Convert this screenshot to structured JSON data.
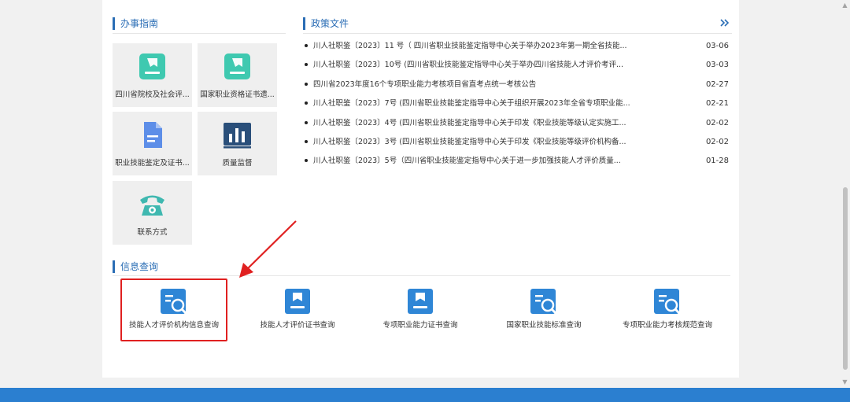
{
  "guide": {
    "title": "办事指南",
    "tiles": [
      {
        "label": "四川省院校及社会评...",
        "icon": "bookmark-book-icon",
        "color": "#3fc9b0"
      },
      {
        "label": "国家职业资格证书遗...",
        "icon": "bookmark-book-icon",
        "color": "#3fc9b0"
      },
      {
        "label": "职业技能鉴定及证书...",
        "icon": "document-icon",
        "color": "#5d8ee8"
      },
      {
        "label": "质量监督",
        "icon": "bar-chart-icon",
        "color": "#2a4f7a"
      },
      {
        "label": "联系方式",
        "icon": "telephone-icon",
        "color": "#3fb8b0"
      }
    ]
  },
  "policy": {
    "title": "政策文件",
    "more_icon": "double-chevron-right-icon",
    "items": [
      {
        "title": "川人社职鉴〔2023〕11 号（ 四川省职业技能鉴定指导中心关于举办2023年第一期全省技能...",
        "date": "03-06"
      },
      {
        "title": "川人社职鉴〔2023〕10号 (四川省职业技能鉴定指导中心关于举办四川省技能人才评价考评...",
        "date": "03-03"
      },
      {
        "title": "四川省2023年度16个专项职业能力考核项目省直考点统一考核公告",
        "date": "02-27"
      },
      {
        "title": "川人社职鉴〔2023〕7号 (四川省职业技能鉴定指导中心关于组织开展2023年全省专项职业能...",
        "date": "02-21"
      },
      {
        "title": "川人社职鉴〔2023〕4号 (四川省职业技能鉴定指导中心关于印发《职业技能等级认定实施工...",
        "date": "02-02"
      },
      {
        "title": "川人社职鉴〔2023〕3号 (四川省职业技能鉴定指导中心关于印发《职业技能等级评价机构备...",
        "date": "02-02"
      },
      {
        "title": "川人社职鉴〔2023〕5号（四川省职业技能鉴定指导中心关于进一步加强技能人才评价质量...",
        "date": "01-28"
      }
    ]
  },
  "query": {
    "title": "信息查询",
    "items": [
      {
        "label": "技能人才评价机构信息查询",
        "icon": "document-search-icon"
      },
      {
        "label": "技能人才评价证书查询",
        "icon": "bookmark-book-icon"
      },
      {
        "label": "专项职业能力证书查询",
        "icon": "bookmark-book-icon"
      },
      {
        "label": "国家职业技能标准查询",
        "icon": "document-search-icon"
      },
      {
        "label": "专项职业能力考核规范查询",
        "icon": "document-search-icon"
      }
    ]
  },
  "colors": {
    "accent": "#2a6db5",
    "icon_blue": "#2f86d6",
    "highlight": "#e02020",
    "footer": "#2b7fd0"
  }
}
